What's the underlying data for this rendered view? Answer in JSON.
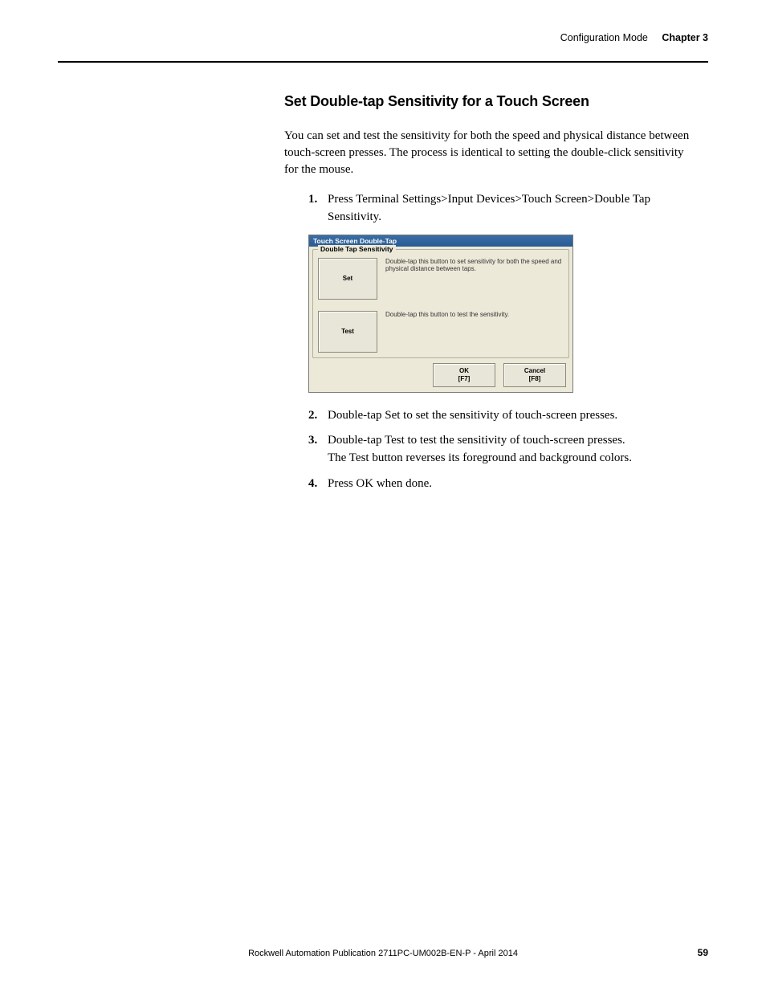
{
  "header": {
    "section": "Configuration Mode",
    "chapter": "Chapter 3"
  },
  "heading": "Set Double-tap Sensitivity for a Touch Screen",
  "intro": "You can set and test the sensitivity for both the speed and physical distance between touch-screen presses. The process is identical to setting the double-click sensitivity for the mouse.",
  "steps": {
    "s1": "Press Terminal Settings>Input Devices>Touch Screen>Double Tap Sensitivity.",
    "s2": "Double-tap Set to set the sensitivity of touch-screen presses.",
    "s3a": "Double-tap Test to test the sensitivity of touch-screen presses.",
    "s3b": "The Test button reverses its foreground and background colors.",
    "s4": "Press OK when done."
  },
  "dialog": {
    "title": "Touch Screen Double-Tap",
    "group_legend": "Double Tap Sensitivity",
    "set_btn": "Set",
    "set_text": "Double-tap this button to set sensitivity for both the speed and physical distance between taps.",
    "test_btn": "Test",
    "test_text": "Double-tap this button to test the sensitivity.",
    "ok_label": "OK",
    "ok_key": "[F7]",
    "cancel_label": "Cancel",
    "cancel_key": "[F8]"
  },
  "footer": "Rockwell Automation Publication 2711PC-UM002B-EN-P - April 2014",
  "page_number": "59"
}
